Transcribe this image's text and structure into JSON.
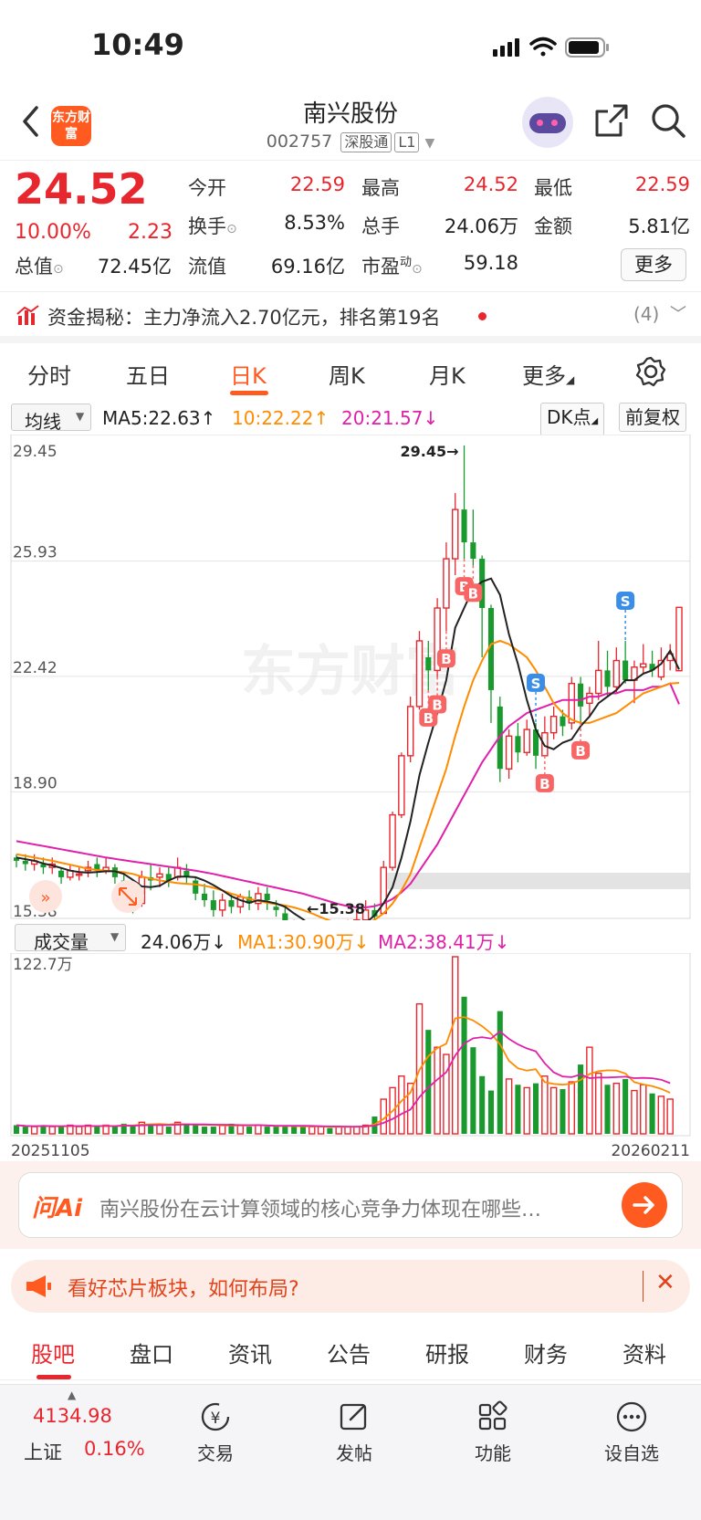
{
  "status": {
    "time": "10:49"
  },
  "header": {
    "logo_text": "东方财富",
    "stock_name": "南兴股份",
    "stock_code": "002757",
    "tag_connect": "深股通",
    "tag_level": "L1"
  },
  "quote": {
    "price": "24.52",
    "change_pct": "10.00%",
    "change": "2.23",
    "rows": [
      [
        {
          "label": "今开",
          "value": "22.59",
          "color": "red"
        },
        {
          "label": "最高",
          "value": "24.52",
          "color": "red"
        },
        {
          "label": "最低",
          "value": "22.59",
          "color": "red"
        }
      ],
      [
        {
          "label": "换手",
          "value": "8.53%",
          "color": "dark"
        },
        {
          "label": "总手",
          "value": "24.06万",
          "color": "dark"
        },
        {
          "label": "金额",
          "value": "5.81亿",
          "color": "dark"
        }
      ],
      [
        {
          "label": "总值",
          "value": "72.45亿",
          "color": "dark"
        },
        {
          "label": "流值",
          "value": "69.16亿",
          "color": "dark"
        },
        {
          "label": "市盈",
          "sup": "动",
          "value": "59.18",
          "color": "dark"
        }
      ]
    ],
    "more_label": "更多"
  },
  "capital": {
    "text": "资金揭秘：主力净流入2.70亿元，排名第19名",
    "count": "(4)"
  },
  "tabs": [
    "分时",
    "五日",
    "日K",
    "周K",
    "月K",
    "更多"
  ],
  "active_tab": 2,
  "indicator": {
    "select": "均线",
    "ma5": "MA5:22.63",
    "ma10": "10:22.22",
    "ma20": "20:21.57",
    "dk": "DK点",
    "adjust": "前复权"
  },
  "volume": {
    "select": "成交量",
    "value": "24.06万",
    "ma1": "MA1:30.90万",
    "ma2": "MA2:38.41万",
    "max_label": "122.7万",
    "date_start": "20251105",
    "date_end": "20260211"
  },
  "ai": {
    "logo": "问Ai",
    "prompt": "南兴股份在云计算领域的核心竞争力体现在哪些…"
  },
  "promo": {
    "text": "看好芯片板块，如何布局?"
  },
  "bottom_tabs": [
    "股吧",
    "盘口",
    "资讯",
    "公告",
    "研报",
    "财务",
    "资料"
  ],
  "footer": {
    "index_value": "4134.98",
    "index_name": "上证",
    "index_pct": "0.16%",
    "items": [
      "交易",
      "发帖",
      "功能",
      "设自选"
    ]
  },
  "chart_data": {
    "type": "candlestick",
    "watermark": "东方财富",
    "y_ticks": [
      "29.45",
      "25.93",
      "22.42",
      "18.90",
      "15.38"
    ],
    "ylim": [
      15.38,
      29.45
    ],
    "annotations": {
      "high": "29.45",
      "low": "15.38"
    },
    "signals": [
      {
        "type": "B",
        "index": 46
      },
      {
        "type": "B",
        "index": 47
      },
      {
        "type": "B",
        "index": 48
      },
      {
        "type": "B",
        "index": 50
      },
      {
        "type": "B",
        "index": 51
      },
      {
        "type": "S",
        "index": 58
      },
      {
        "type": "B",
        "index": 59
      },
      {
        "type": "B",
        "index": 63
      },
      {
        "type": "S",
        "index": 68
      }
    ],
    "candles": [
      [
        16.9,
        16.8,
        17.0,
        16.6
      ],
      [
        16.8,
        16.7,
        17.0,
        16.5
      ],
      [
        16.7,
        16.8,
        17.0,
        16.5
      ],
      [
        16.7,
        16.6,
        16.9,
        16.4
      ],
      [
        16.6,
        16.7,
        16.9,
        16.4
      ],
      [
        16.5,
        16.3,
        16.6,
        16.1
      ],
      [
        16.3,
        16.5,
        16.7,
        16.2
      ],
      [
        16.4,
        16.4,
        16.6,
        16.2
      ],
      [
        16.5,
        16.6,
        16.8,
        16.3
      ],
      [
        16.7,
        16.5,
        16.9,
        16.3
      ],
      [
        16.5,
        16.6,
        16.9,
        16.4
      ],
      [
        16.6,
        16.3,
        16.7,
        16.1
      ],
      [
        16.2,
        16.0,
        16.4,
        15.8
      ],
      [
        15.9,
        15.4,
        16.0,
        15.2
      ],
      [
        15.5,
        16.3,
        16.5,
        15.4
      ],
      [
        16.3,
        16.2,
        16.7,
        15.9
      ],
      [
        16.3,
        16.4,
        16.6,
        16.0
      ],
      [
        16.4,
        16.2,
        16.6,
        16.0
      ],
      [
        16.3,
        16.6,
        16.9,
        16.2
      ],
      [
        16.5,
        16.3,
        16.7,
        16.1
      ],
      [
        16.2,
        15.8,
        16.3,
        15.6
      ],
      [
        15.8,
        15.6,
        16.1,
        15.4
      ],
      [
        15.6,
        15.3,
        15.9,
        15.1
      ],
      [
        15.3,
        15.6,
        15.8,
        15.1
      ],
      [
        15.6,
        15.4,
        15.8,
        15.2
      ],
      [
        15.4,
        15.7,
        15.8,
        15.2
      ],
      [
        15.7,
        15.5,
        15.9,
        15.3
      ],
      [
        15.5,
        15.8,
        16.0,
        15.3
      ],
      [
        15.8,
        15.6,
        16.0,
        15.3
      ],
      [
        15.4,
        15.3,
        15.6,
        15.1
      ],
      [
        15.2,
        14.9,
        15.4,
        14.8
      ],
      [
        14.9,
        14.6,
        15.0,
        14.3
      ],
      [
        14.6,
        14.4,
        14.7,
        14.2
      ],
      [
        14.4,
        14.5,
        14.7,
        14.2
      ],
      [
        14.5,
        14.7,
        14.9,
        14.3
      ],
      [
        14.7,
        14.5,
        14.8,
        14.3
      ],
      [
        14.5,
        14.6,
        14.8,
        14.3
      ],
      [
        14.6,
        14.8,
        15.0,
        14.5
      ],
      [
        14.8,
        15.0,
        15.3,
        14.7
      ],
      [
        15.0,
        15.3,
        15.6,
        14.9
      ],
      [
        15.3,
        15.1,
        15.5,
        14.9
      ],
      [
        15.2,
        16.6,
        16.8,
        15.2
      ],
      [
        16.6,
        18.2,
        18.3,
        16.5
      ],
      [
        18.2,
        20.0,
        20.1,
        18.1
      ],
      [
        20.0,
        21.5,
        21.8,
        19.8
      ],
      [
        21.5,
        23.5,
        23.8,
        21.4
      ],
      [
        23.0,
        22.6,
        23.5,
        22.0
      ],
      [
        22.6,
        24.5,
        24.8,
        22.4
      ],
      [
        24.5,
        26.0,
        26.5,
        23.8
      ],
      [
        26.0,
        27.5,
        28.0,
        25.5
      ],
      [
        27.5,
        26.5,
        29.45,
        26.0
      ],
      [
        26.5,
        26.0,
        27.5,
        25.8
      ],
      [
        26.0,
        24.5,
        26.1,
        23.0
      ],
      [
        24.5,
        22.0,
        24.6,
        21.0
      ],
      [
        21.5,
        19.6,
        21.8,
        19.2
      ],
      [
        19.6,
        20.6,
        20.8,
        19.3
      ],
      [
        20.6,
        20.1,
        21.0,
        19.8
      ],
      [
        20.1,
        20.8,
        21.1,
        20.0
      ],
      [
        20.8,
        20.0,
        21.0,
        19.6
      ],
      [
        20.0,
        20.7,
        21.2,
        20.0
      ],
      [
        20.7,
        21.2,
        21.5,
        20.5
      ],
      [
        21.2,
        20.9,
        21.4,
        20.6
      ],
      [
        21.0,
        22.2,
        22.4,
        20.8
      ],
      [
        22.2,
        21.5,
        22.4,
        21.0
      ],
      [
        21.6,
        21.9,
        22.1,
        21.2
      ],
      [
        21.9,
        22.6,
        23.5,
        21.7
      ],
      [
        22.6,
        22.1,
        23.2,
        21.8
      ],
      [
        22.1,
        22.9,
        23.3,
        21.9
      ],
      [
        22.9,
        22.3,
        23.5,
        22.2
      ],
      [
        22.3,
        22.7,
        22.9,
        21.6
      ],
      [
        22.7,
        22.8,
        23.4,
        22.5
      ],
      [
        22.8,
        22.6,
        23.2,
        22.4
      ],
      [
        22.4,
        22.9,
        23.3,
        22.3
      ],
      [
        22.9,
        23.1,
        23.4,
        22.6
      ],
      [
        22.59,
        24.52,
        24.52,
        22.59
      ]
    ],
    "volumes": [
      6,
      5,
      5,
      6,
      5,
      5,
      6,
      5,
      6,
      5,
      6,
      5,
      7,
      6,
      8,
      7,
      6,
      5,
      8,
      7,
      6,
      5,
      5,
      6,
      7,
      6,
      5,
      6,
      5,
      5,
      6,
      5,
      5,
      5,
      5,
      4,
      5,
      5,
      5,
      6,
      12,
      24,
      32,
      40,
      35,
      90,
      72,
      60,
      55,
      122.7,
      95,
      60,
      40,
      30,
      85,
      38,
      34,
      32,
      35,
      40,
      32,
      31,
      36,
      48,
      60,
      42,
      34,
      35,
      38,
      30,
      34,
      28,
      26,
      24.06
    ],
    "ma5": [
      16.9,
      16.85,
      16.8,
      16.72,
      16.66,
      16.58,
      16.5,
      16.46,
      16.44,
      16.46,
      16.48,
      16.48,
      16.4,
      16.22,
      16.02,
      16.0,
      16.04,
      16.2,
      16.32,
      16.32,
      16.3,
      16.2,
      16.06,
      15.9,
      15.72,
      15.6,
      15.52,
      15.6,
      15.56,
      15.5,
      15.4,
      15.2,
      15.02,
      14.8,
      14.6,
      14.54,
      14.58,
      14.64,
      14.74,
      14.9,
      15.14,
      15.5,
      16.0,
      16.9,
      18.0,
      19.4,
      20.4,
      21.3,
      22.3,
      23.9,
      24.5,
      25.1,
      25.3,
      25.4,
      24.9,
      23.7,
      22.8,
      21.7,
      20.8,
      20.3,
      20.2,
      20.4,
      20.5,
      20.9,
      21.2,
      21.6,
      21.8,
      22.0,
      22.3,
      22.3,
      22.5,
      22.6,
      22.8,
      23.2,
      22.63
    ],
    "ma10": [
      17.0,
      16.95,
      16.9,
      16.85,
      16.8,
      16.74,
      16.68,
      16.62,
      16.56,
      16.52,
      16.5,
      16.48,
      16.45,
      16.4,
      16.32,
      16.26,
      16.2,
      16.16,
      16.12,
      16.1,
      16.08,
      16.04,
      15.98,
      15.9,
      15.8,
      15.72,
      15.64,
      15.58,
      15.52,
      15.48,
      15.44,
      15.38,
      15.3,
      15.2,
      15.08,
      14.98,
      14.9,
      14.86,
      14.86,
      14.9,
      15.0,
      15.2,
      15.5,
      15.9,
      16.4,
      17.2,
      18.0,
      18.8,
      19.6,
      20.6,
      21.5,
      22.3,
      22.9,
      23.4,
      23.5,
      23.4,
      23.2,
      23.0,
      22.6,
      22.1,
      21.6,
      21.3,
      21.1,
      21.0,
      21.0,
      21.1,
      21.2,
      21.3,
      21.5,
      21.7,
      21.9,
      22.0,
      22.1,
      22.2,
      22.22
    ],
    "ma20": [
      17.4,
      17.35,
      17.3,
      17.25,
      17.2,
      17.15,
      17.1,
      17.05,
      17.0,
      16.95,
      16.9,
      16.86,
      16.82,
      16.78,
      16.74,
      16.7,
      16.66,
      16.62,
      16.58,
      16.54,
      16.5,
      16.45,
      16.4,
      16.34,
      16.28,
      16.22,
      16.16,
      16.1,
      16.04,
      15.98,
      15.92,
      15.86,
      15.8,
      15.72,
      15.64,
      15.56,
      15.48,
      15.42,
      15.38,
      15.38,
      15.42,
      15.5,
      15.64,
      15.84,
      16.1,
      16.5,
      16.9,
      17.3,
      17.8,
      18.3,
      18.8,
      19.3,
      19.8,
      20.2,
      20.6,
      20.9,
      21.1,
      21.3,
      21.4,
      21.5,
      21.6,
      21.7,
      21.7,
      21.7,
      21.8,
      21.8,
      21.9,
      21.9,
      22.0,
      22.0,
      22.0,
      22.1,
      22.1,
      22.2,
      21.57
    ]
  },
  "colors": {
    "up": "#e8262d",
    "down": "#1a9a2e",
    "ma5": "#222222",
    "ma10": "#ff8c00",
    "ma20": "#e020a8",
    "accent": "#ff5a1f"
  }
}
